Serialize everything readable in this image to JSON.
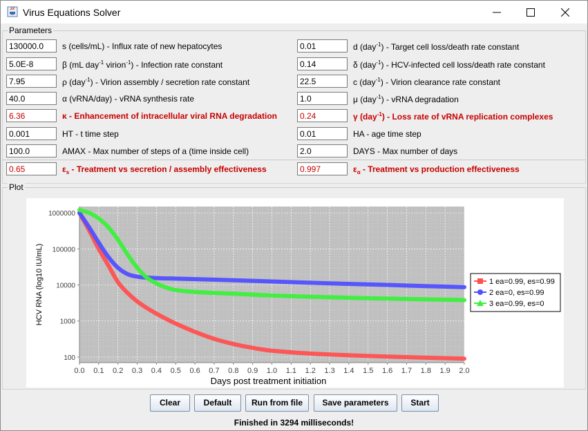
{
  "window": {
    "title": "Virus Equations Solver"
  },
  "parameters": {
    "group_label": "Parameters",
    "left": [
      {
        "value": "130000.0",
        "label": "s (cells/mL) - Influx rate of new hepatocytes",
        "red": false
      },
      {
        "value": "5.0E-8",
        "label_html": "β (mL day<sup>-1</sup> virion<sup>-1</sup>) - Infection rate constant",
        "label": "β (mL day-1 virion-1) - Infection rate constant",
        "red": false
      },
      {
        "value": "7.95",
        "label": "ρ (day-1) - Virion assembly / secretion rate constant",
        "red": false
      },
      {
        "value": "40.0",
        "label": "α (vRNA/day) - vRNA synthesis rate",
        "red": false
      },
      {
        "value": "6.36",
        "label": "κ - Enhancement of intracellular viral RNA degradation",
        "red": true
      },
      {
        "value": "0.001",
        "label": "HT - t time step",
        "red": false
      },
      {
        "value": "100.0",
        "label": "AMAX - Max number of steps of a (time inside cell)",
        "red": false
      },
      {
        "value": "0.65",
        "label": "εs - Treatment vs secretion / assembly effectiveness",
        "red": true
      }
    ],
    "right": [
      {
        "value": "0.01",
        "label": "d (day-1) - Target cell loss/death rate constant",
        "red": false
      },
      {
        "value": "0.14",
        "label": "δ (day-1) - HCV-infected cell loss/death rate constant",
        "red": false
      },
      {
        "value": "22.5",
        "label": "c (day-1) - Virion clearance rate constant",
        "red": false
      },
      {
        "value": "1.0",
        "label": "μ (day-1) - vRNA degradation",
        "red": false
      },
      {
        "value": "0.24",
        "label": "γ (day-1) - Loss rate of vRNA replication complexes",
        "red": true
      },
      {
        "value": "0.01",
        "label": "HA - age time step",
        "red": false
      },
      {
        "value": "2.0",
        "label": "DAYS - Max number of days",
        "red": false
      },
      {
        "value": "0.997",
        "label": "εα - Treatment vs production effectiveness",
        "red": true
      }
    ]
  },
  "plot": {
    "group_label": "Plot",
    "chart_data": {
      "type": "line",
      "xlabel": "Days post treatment initiation",
      "ylabel": "HCV RNA (log10 IU/mL)",
      "xlim": [
        0.0,
        2.0
      ],
      "x_ticks": [
        "0.0",
        "0.1",
        "0.2",
        "0.3",
        "0.4",
        "0.5",
        "0.6",
        "0.7",
        "0.8",
        "0.9",
        "1.0",
        "1.1",
        "1.2",
        "1.3",
        "1.4",
        "1.5",
        "1.6",
        "1.7",
        "1.8",
        "1.9",
        "2.0"
      ],
      "y_scale": "log",
      "ylim": [
        70,
        1500000
      ],
      "y_ticks": [
        "100",
        "1000",
        "10000",
        "100000",
        "1000000"
      ],
      "y_tick_values": [
        100,
        1000,
        10000,
        100000,
        1000000
      ],
      "grid": true,
      "legend_position": "right",
      "x": [
        0.0,
        0.05,
        0.1,
        0.15,
        0.2,
        0.25,
        0.3,
        0.35,
        0.4,
        0.45,
        0.5,
        0.6,
        0.7,
        0.8,
        0.9,
        1.0,
        1.2,
        1.4,
        1.6,
        1.8,
        2.0
      ],
      "series": [
        {
          "name": "1 ea=0.99, es=0.99",
          "color": "#ff5050",
          "marker": "square",
          "values": [
            1000000,
            330000,
            100000,
            35000,
            12000,
            6000,
            3500,
            2300,
            1600,
            1150,
            850,
            500,
            320,
            230,
            180,
            150,
            125,
            112,
            103,
            96,
            90
          ]
        },
        {
          "name": "2 ea=0, es=0.99",
          "color": "#5050ff",
          "marker": "circle",
          "values": [
            1000000,
            400000,
            150000,
            60000,
            30000,
            20000,
            17000,
            16000,
            15500,
            15200,
            15000,
            14500,
            14000,
            13500,
            13000,
            12500,
            11500,
            10700,
            10000,
            9300,
            8700
          ]
        },
        {
          "name": "3 ea=0.99, es=0",
          "color": "#3cf03c",
          "marker": "triangle",
          "values": [
            1200000,
            1000000,
            700000,
            400000,
            180000,
            70000,
            30000,
            16000,
            11000,
            8500,
            7200,
            6400,
            6000,
            5700,
            5400,
            5100,
            4700,
            4400,
            4200,
            4000,
            3800
          ]
        }
      ]
    }
  },
  "buttons": {
    "clear": "Clear",
    "default": "Default",
    "run_from_file": "Run from file",
    "save_parameters": "Save parameters",
    "start": "Start"
  },
  "status": "Finished in 3294 milliseconds!"
}
